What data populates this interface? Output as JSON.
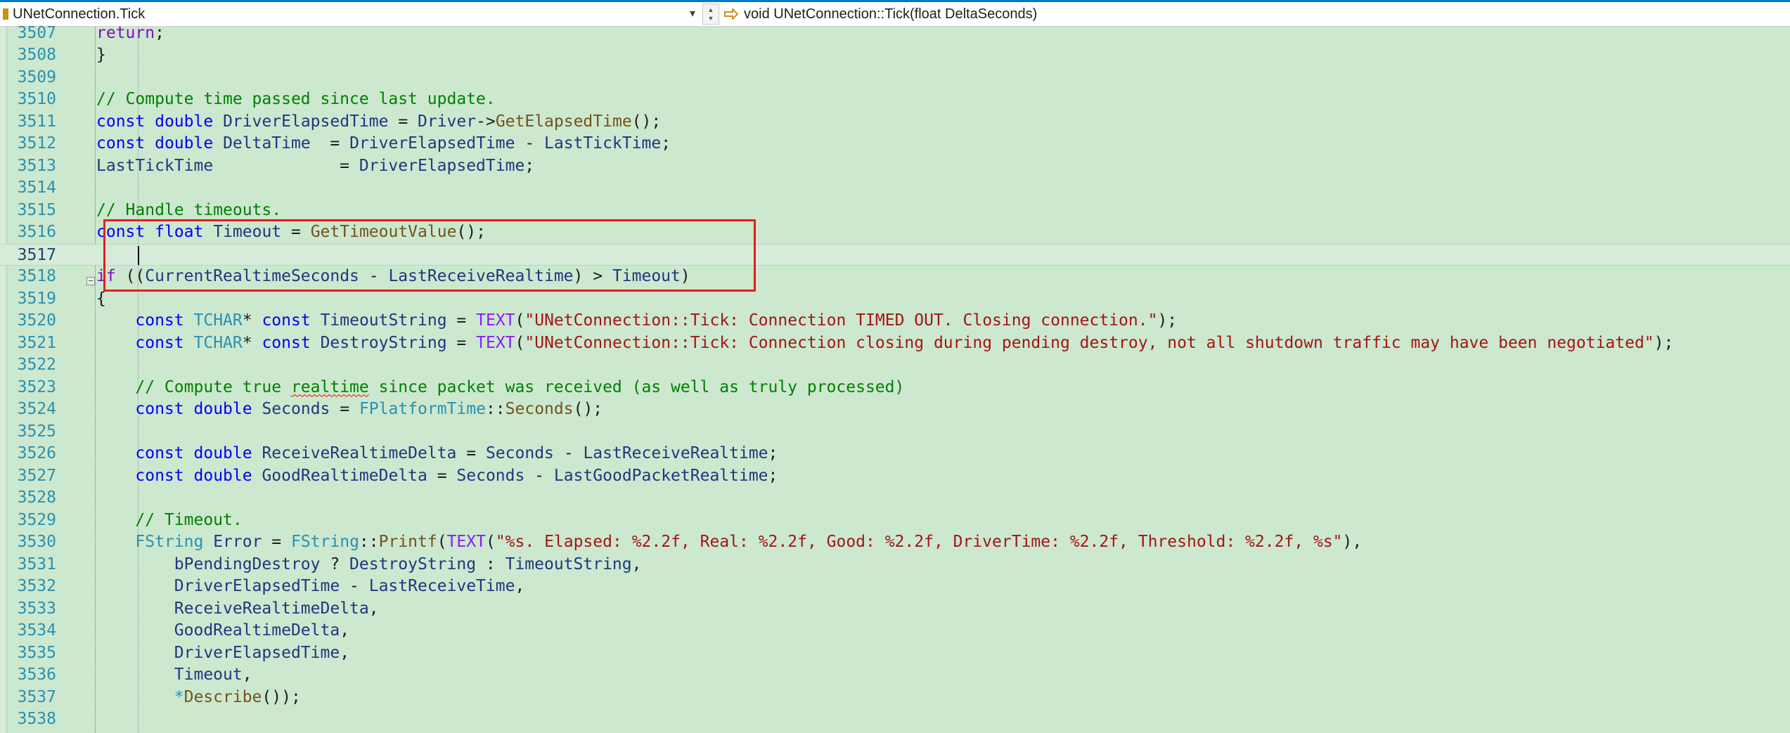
{
  "navbar": {
    "scope": "UNetConnection.Tick",
    "member": "void UNetConnection::Tick(float DeltaSeconds)",
    "icons": {
      "scope_icon": "class-icon",
      "member_icon": "method-icon",
      "split_icon": "split-arrows-icon",
      "dropdown_icon": "chevron-down-icon"
    },
    "colors": {
      "accent": "#007acc",
      "editor_background": "#cce8cf",
      "selection_box": "#e02020"
    }
  },
  "editor": {
    "current_line": "3517",
    "lines": [
      {
        "n": "3507",
        "tokens": [
          {
            "t": "return",
            "c": "ctl"
          },
          {
            "t": ";",
            "c": "p"
          }
        ]
      },
      {
        "n": "3508",
        "tokens": [
          {
            "t": "}",
            "c": "p"
          }
        ]
      },
      {
        "n": "3509",
        "tokens": []
      },
      {
        "n": "3510",
        "tokens": [
          {
            "t": "// Compute time passed since last update.",
            "c": "cmt"
          }
        ]
      },
      {
        "n": "3511",
        "tokens": [
          {
            "t": "const",
            "c": "kw"
          },
          {
            "t": " ",
            "c": "p"
          },
          {
            "t": "double",
            "c": "kw"
          },
          {
            "t": " ",
            "c": "p"
          },
          {
            "t": "DriverElapsedTime",
            "c": "var"
          },
          {
            "t": " = ",
            "c": "p"
          },
          {
            "t": "Driver",
            "c": "var"
          },
          {
            "t": "->",
            "c": "p"
          },
          {
            "t": "GetElapsedTime",
            "c": "fn"
          },
          {
            "t": "();",
            "c": "p"
          }
        ]
      },
      {
        "n": "3512",
        "tokens": [
          {
            "t": "const",
            "c": "kw"
          },
          {
            "t": " ",
            "c": "p"
          },
          {
            "t": "double",
            "c": "kw"
          },
          {
            "t": " ",
            "c": "p"
          },
          {
            "t": "DeltaTime",
            "c": "var"
          },
          {
            "t": "  = ",
            "c": "p"
          },
          {
            "t": "DriverElapsedTime",
            "c": "var"
          },
          {
            "t": " - ",
            "c": "p"
          },
          {
            "t": "LastTickTime",
            "c": "var"
          },
          {
            "t": ";",
            "c": "p"
          }
        ]
      },
      {
        "n": "3513",
        "tokens": [
          {
            "t": "LastTickTime",
            "c": "var"
          },
          {
            "t": "             = ",
            "c": "p"
          },
          {
            "t": "DriverElapsedTime",
            "c": "var"
          },
          {
            "t": ";",
            "c": "p"
          }
        ]
      },
      {
        "n": "3514",
        "tokens": []
      },
      {
        "n": "3515",
        "tokens": [
          {
            "t": "// Handle timeouts.",
            "c": "cmt"
          }
        ]
      },
      {
        "n": "3516",
        "tokens": [
          {
            "t": "const",
            "c": "kw"
          },
          {
            "t": " ",
            "c": "p"
          },
          {
            "t": "float",
            "c": "kw"
          },
          {
            "t": " ",
            "c": "p"
          },
          {
            "t": "Timeout",
            "c": "var"
          },
          {
            "t": " = ",
            "c": "p"
          },
          {
            "t": "GetTimeoutValue",
            "c": "fn"
          },
          {
            "t": "();",
            "c": "p"
          }
        ]
      },
      {
        "n": "3517",
        "tokens": []
      },
      {
        "n": "3518",
        "tokens": [
          {
            "t": "if",
            "c": "ctl"
          },
          {
            "t": " ((",
            "c": "p"
          },
          {
            "t": "CurrentRealtimeSeconds",
            "c": "var"
          },
          {
            "t": " - ",
            "c": "p"
          },
          {
            "t": "LastReceiveRealtime",
            "c": "var"
          },
          {
            "t": ") > ",
            "c": "p"
          },
          {
            "t": "Timeout",
            "c": "var"
          },
          {
            "t": ")",
            "c": "p"
          }
        ]
      },
      {
        "n": "3519",
        "tokens": [
          {
            "t": "{",
            "c": "p"
          }
        ]
      },
      {
        "n": "3520",
        "tokens": [
          {
            "t": "    ",
            "c": "p"
          },
          {
            "t": "const",
            "c": "kw"
          },
          {
            "t": " ",
            "c": "p"
          },
          {
            "t": "TCHAR",
            "c": "type"
          },
          {
            "t": "* ",
            "c": "p"
          },
          {
            "t": "const",
            "c": "kw"
          },
          {
            "t": " ",
            "c": "p"
          },
          {
            "t": "TimeoutString",
            "c": "var"
          },
          {
            "t": " = ",
            "c": "p"
          },
          {
            "t": "TEXT",
            "c": "mac"
          },
          {
            "t": "(",
            "c": "p"
          },
          {
            "t": "\"UNetConnection::Tick: Connection TIMED OUT. Closing connection.\"",
            "c": "str"
          },
          {
            "t": ");",
            "c": "p"
          }
        ]
      },
      {
        "n": "3521",
        "tokens": [
          {
            "t": "    ",
            "c": "p"
          },
          {
            "t": "const",
            "c": "kw"
          },
          {
            "t": " ",
            "c": "p"
          },
          {
            "t": "TCHAR",
            "c": "type"
          },
          {
            "t": "* ",
            "c": "p"
          },
          {
            "t": "const",
            "c": "kw"
          },
          {
            "t": " ",
            "c": "p"
          },
          {
            "t": "DestroyString",
            "c": "var"
          },
          {
            "t": " = ",
            "c": "p"
          },
          {
            "t": "TEXT",
            "c": "mac"
          },
          {
            "t": "(",
            "c": "p"
          },
          {
            "t": "\"UNetConnection::Tick: Connection closing during pending destroy, not all shutdown traffic may have been negotiated\"",
            "c": "str"
          },
          {
            "t": ");",
            "c": "p"
          }
        ]
      },
      {
        "n": "3522",
        "tokens": []
      },
      {
        "n": "3523",
        "tokens": [
          {
            "t": "    ",
            "c": "p"
          },
          {
            "t": "// Compute true ",
            "c": "cmt"
          },
          {
            "t": "realtime",
            "c": "cmt",
            "sq": true
          },
          {
            "t": " since packet was received (as well as truly processed)",
            "c": "cmt"
          }
        ]
      },
      {
        "n": "3524",
        "tokens": [
          {
            "t": "    ",
            "c": "p"
          },
          {
            "t": "const",
            "c": "kw"
          },
          {
            "t": " ",
            "c": "p"
          },
          {
            "t": "double",
            "c": "kw"
          },
          {
            "t": " ",
            "c": "p"
          },
          {
            "t": "Seconds",
            "c": "var"
          },
          {
            "t": " = ",
            "c": "p"
          },
          {
            "t": "FPlatformTime",
            "c": "type"
          },
          {
            "t": "::",
            "c": "p"
          },
          {
            "t": "Seconds",
            "c": "fn"
          },
          {
            "t": "();",
            "c": "p"
          }
        ]
      },
      {
        "n": "3525",
        "tokens": []
      },
      {
        "n": "3526",
        "tokens": [
          {
            "t": "    ",
            "c": "p"
          },
          {
            "t": "const",
            "c": "kw"
          },
          {
            "t": " ",
            "c": "p"
          },
          {
            "t": "double",
            "c": "kw"
          },
          {
            "t": " ",
            "c": "p"
          },
          {
            "t": "ReceiveRealtimeDelta",
            "c": "var"
          },
          {
            "t": " = ",
            "c": "p"
          },
          {
            "t": "Seconds",
            "c": "var"
          },
          {
            "t": " - ",
            "c": "p"
          },
          {
            "t": "LastReceiveRealtime",
            "c": "var"
          },
          {
            "t": ";",
            "c": "p"
          }
        ]
      },
      {
        "n": "3527",
        "tokens": [
          {
            "t": "    ",
            "c": "p"
          },
          {
            "t": "const",
            "c": "kw"
          },
          {
            "t": " ",
            "c": "p"
          },
          {
            "t": "double",
            "c": "kw"
          },
          {
            "t": " ",
            "c": "p"
          },
          {
            "t": "GoodRealtimeDelta",
            "c": "var"
          },
          {
            "t": " = ",
            "c": "p"
          },
          {
            "t": "Seconds",
            "c": "var"
          },
          {
            "t": " - ",
            "c": "p"
          },
          {
            "t": "LastGoodPacketRealtime",
            "c": "var"
          },
          {
            "t": ";",
            "c": "p"
          }
        ]
      },
      {
        "n": "3528",
        "tokens": []
      },
      {
        "n": "3529",
        "tokens": [
          {
            "t": "    ",
            "c": "p"
          },
          {
            "t": "// Timeout.",
            "c": "cmt"
          }
        ]
      },
      {
        "n": "3530",
        "tokens": [
          {
            "t": "    ",
            "c": "p"
          },
          {
            "t": "FString",
            "c": "type"
          },
          {
            "t": " ",
            "c": "p"
          },
          {
            "t": "Error",
            "c": "var"
          },
          {
            "t": " = ",
            "c": "p"
          },
          {
            "t": "FString",
            "c": "type"
          },
          {
            "t": "::",
            "c": "p"
          },
          {
            "t": "Printf",
            "c": "fn"
          },
          {
            "t": "(",
            "c": "p"
          },
          {
            "t": "TEXT",
            "c": "mac"
          },
          {
            "t": "(",
            "c": "p"
          },
          {
            "t": "\"%s. Elapsed: %2.2f, Real: %2.2f, Good: %2.2f, DriverTime: %2.2f, Threshold: %2.2f, %s\"",
            "c": "str"
          },
          {
            "t": "),",
            "c": "p"
          }
        ]
      },
      {
        "n": "3531",
        "tokens": [
          {
            "t": "        ",
            "c": "p"
          },
          {
            "t": "bPendingDestroy",
            "c": "var"
          },
          {
            "t": " ? ",
            "c": "p"
          },
          {
            "t": "DestroyString",
            "c": "var"
          },
          {
            "t": " : ",
            "c": "p"
          },
          {
            "t": "TimeoutString",
            "c": "var"
          },
          {
            "t": ",",
            "c": "p"
          }
        ]
      },
      {
        "n": "3532",
        "tokens": [
          {
            "t": "        ",
            "c": "p"
          },
          {
            "t": "DriverElapsedTime",
            "c": "var"
          },
          {
            "t": " - ",
            "c": "p"
          },
          {
            "t": "LastReceiveTime",
            "c": "var"
          },
          {
            "t": ",",
            "c": "p"
          }
        ]
      },
      {
        "n": "3533",
        "tokens": [
          {
            "t": "        ",
            "c": "p"
          },
          {
            "t": "ReceiveRealtimeDelta",
            "c": "var"
          },
          {
            "t": ",",
            "c": "p"
          }
        ]
      },
      {
        "n": "3534",
        "tokens": [
          {
            "t": "        ",
            "c": "p"
          },
          {
            "t": "GoodRealtimeDelta",
            "c": "var"
          },
          {
            "t": ",",
            "c": "p"
          }
        ]
      },
      {
        "n": "3535",
        "tokens": [
          {
            "t": "        ",
            "c": "p"
          },
          {
            "t": "DriverElapsedTime",
            "c": "var"
          },
          {
            "t": ",",
            "c": "p"
          }
        ]
      },
      {
        "n": "3536",
        "tokens": [
          {
            "t": "        ",
            "c": "p"
          },
          {
            "t": "Timeout",
            "c": "var"
          },
          {
            "t": ",",
            "c": "p"
          }
        ]
      },
      {
        "n": "3537",
        "tokens": [
          {
            "t": "        ",
            "c": "p"
          },
          {
            "t": "*",
            "c": "type"
          },
          {
            "t": "Describe",
            "c": "fn"
          },
          {
            "t": "());",
            "c": "p"
          }
        ]
      },
      {
        "n": "3538",
        "tokens": []
      }
    ]
  }
}
